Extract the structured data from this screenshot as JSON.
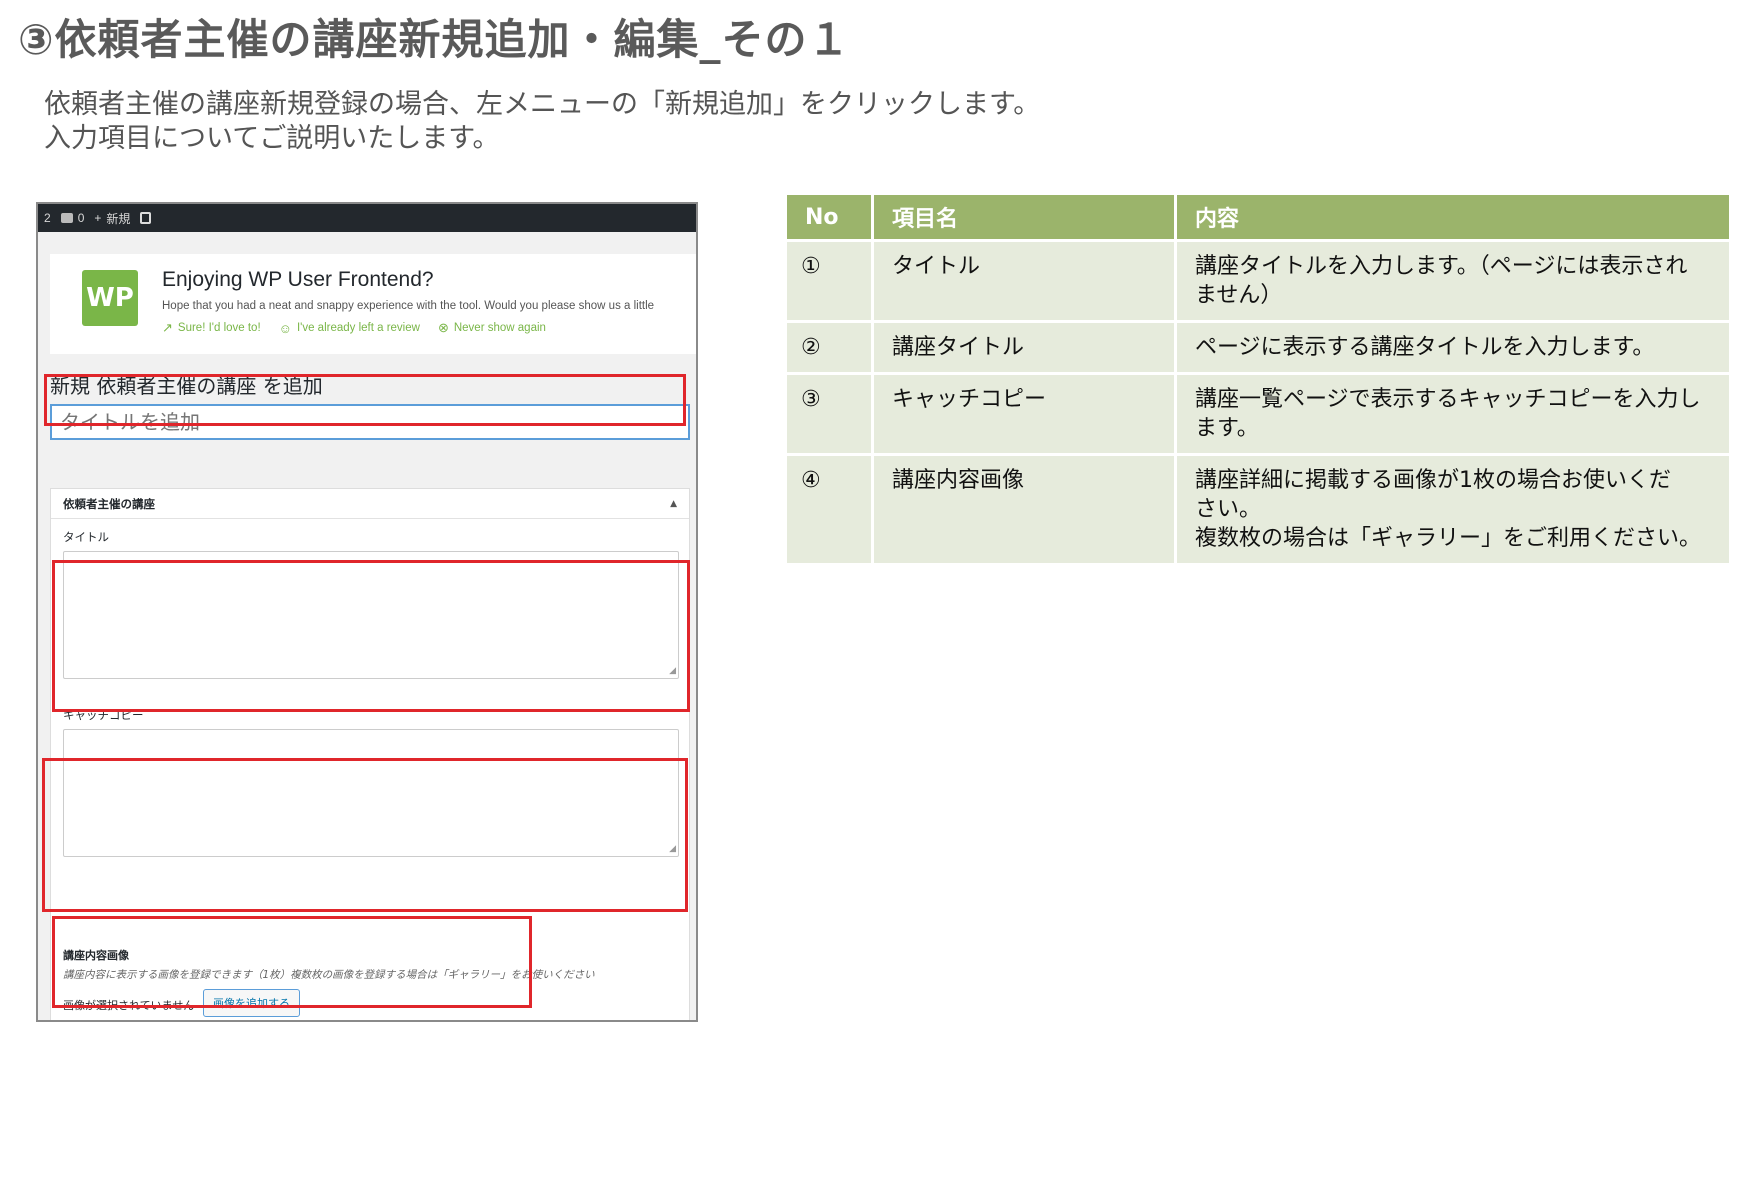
{
  "slide": {
    "title": "③依頼者主催の講座新規追加・編集_その１",
    "intro_line1": "依頼者主催の講座新規登録の場合、左メニューの「新規追加」をクリックします。",
    "intro_line2": "入力項目についてご説明いたします。"
  },
  "screenshot": {
    "adminbar": {
      "updates_count": "2",
      "comments_count": "0",
      "new_label": "新規"
    },
    "notice": {
      "logo_text": "WP",
      "title": "Enjoying WP User Frontend?",
      "text": "Hope that you had a neat and snappy experience with the tool. Would you please show us a little",
      "links": [
        "Sure! I'd love to!",
        "I've already left a review",
        "Never show again"
      ]
    },
    "add_heading": "新規 依頼者主催の講座 を追加",
    "title_placeholder": "タイトルを追加",
    "metabox": {
      "title": "依頼者主催の講座",
      "field_title_label": "タイトル",
      "field_catch_label": "キャッチコピー",
      "image_label": "講座内容画像",
      "image_help": "講座内容に表示する画像を登録できます（1枚）複数枚の画像を登録する場合は「ギャラリー」をお使いください",
      "image_status": "画像が選択されていません",
      "image_button": "画像を追加する"
    }
  },
  "table": {
    "headers": [
      "No",
      "項目名",
      "内容"
    ],
    "rows": [
      {
        "no": "①",
        "name": "タイトル",
        "content_line1": "講座タイトルを入力します。（ページには表示され",
        "content_line2": "ません）",
        "content_line3": ""
      },
      {
        "no": "②",
        "name": "講座タイトル",
        "content_line1": "ページに表示する講座タイトルを入力します。",
        "content_line2": "",
        "content_line3": ""
      },
      {
        "no": "③",
        "name": "キャッチコピー",
        "content_line1": "講座一覧ページで表示するキャッチコピーを入力し",
        "content_line2": "ます。",
        "content_line3": ""
      },
      {
        "no": "④",
        "name": "講座内容画像",
        "content_line1": "講座詳細に掲載する画像が1枚の場合お使いくだ",
        "content_line2": "さい。",
        "content_line3": "複数枚の場合は「ギャラリー」をご利用ください。"
      }
    ]
  },
  "colors": {
    "table_header": "#9bb46b",
    "table_cell": "#e6ebdc",
    "highlight": "#e0262b",
    "logo": "#7ab648"
  }
}
